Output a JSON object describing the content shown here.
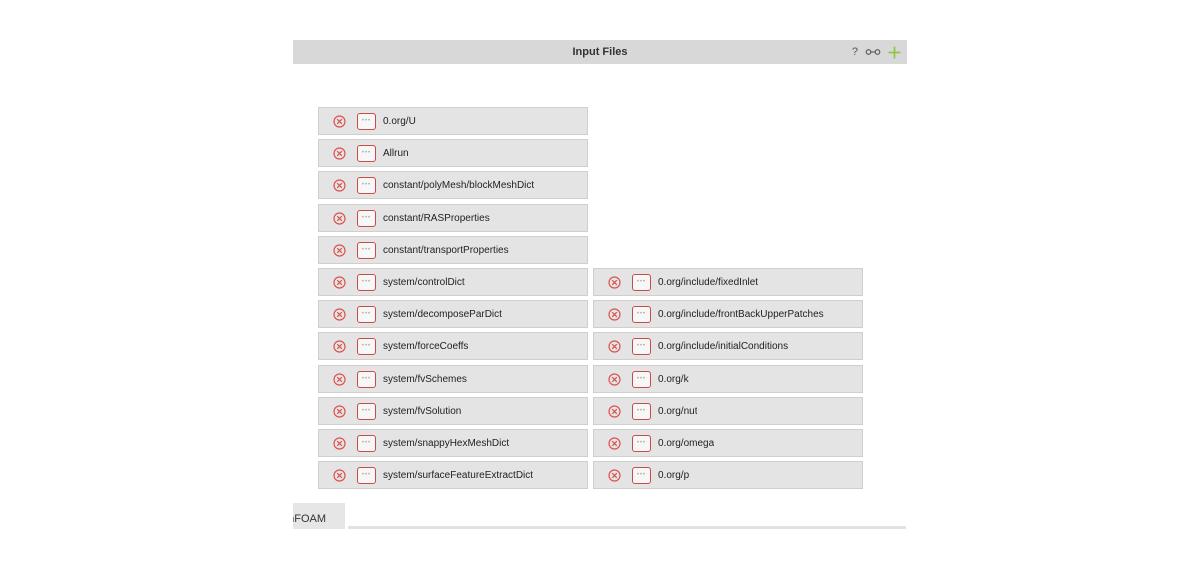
{
  "panel": {
    "title": "Input Files",
    "help_label": "?"
  },
  "icons": {
    "remove": "circled-x-icon",
    "more": "ellipsis-icon",
    "link": "link-icon",
    "add": "plus-icon",
    "help": "question-icon"
  },
  "colors": {
    "header_bg": "#d8d8d8",
    "row_bg": "#e4e4e4",
    "remove_red": "#d9534f",
    "add_green": "#8cc63f"
  },
  "files_left": [
    {
      "label": "0.org/U"
    },
    {
      "label": "Allrun"
    },
    {
      "label": "constant/polyMesh/blockMeshDict"
    },
    {
      "label": "constant/RASProperties"
    },
    {
      "label": "constant/transportProperties"
    },
    {
      "label": "system/controlDict"
    },
    {
      "label": "system/decomposeParDict"
    },
    {
      "label": "system/forceCoeffs"
    },
    {
      "label": "system/fvSchemes"
    },
    {
      "label": "system/fvSolution"
    },
    {
      "label": "system/snappyHexMeshDict"
    },
    {
      "label": "system/surfaceFeatureExtractDict"
    }
  ],
  "files_right": [
    {
      "label": "0.org/include/fixedInlet"
    },
    {
      "label": "0.org/include/frontBackUpperPatches"
    },
    {
      "label": "0.org/include/initialConditions"
    },
    {
      "label": "0.org/k"
    },
    {
      "label": "0.org/nut"
    },
    {
      "label": "0.org/omega"
    },
    {
      "label": "0.org/p"
    }
  ],
  "bottom_tab": {
    "label": "OpenFOAM"
  }
}
